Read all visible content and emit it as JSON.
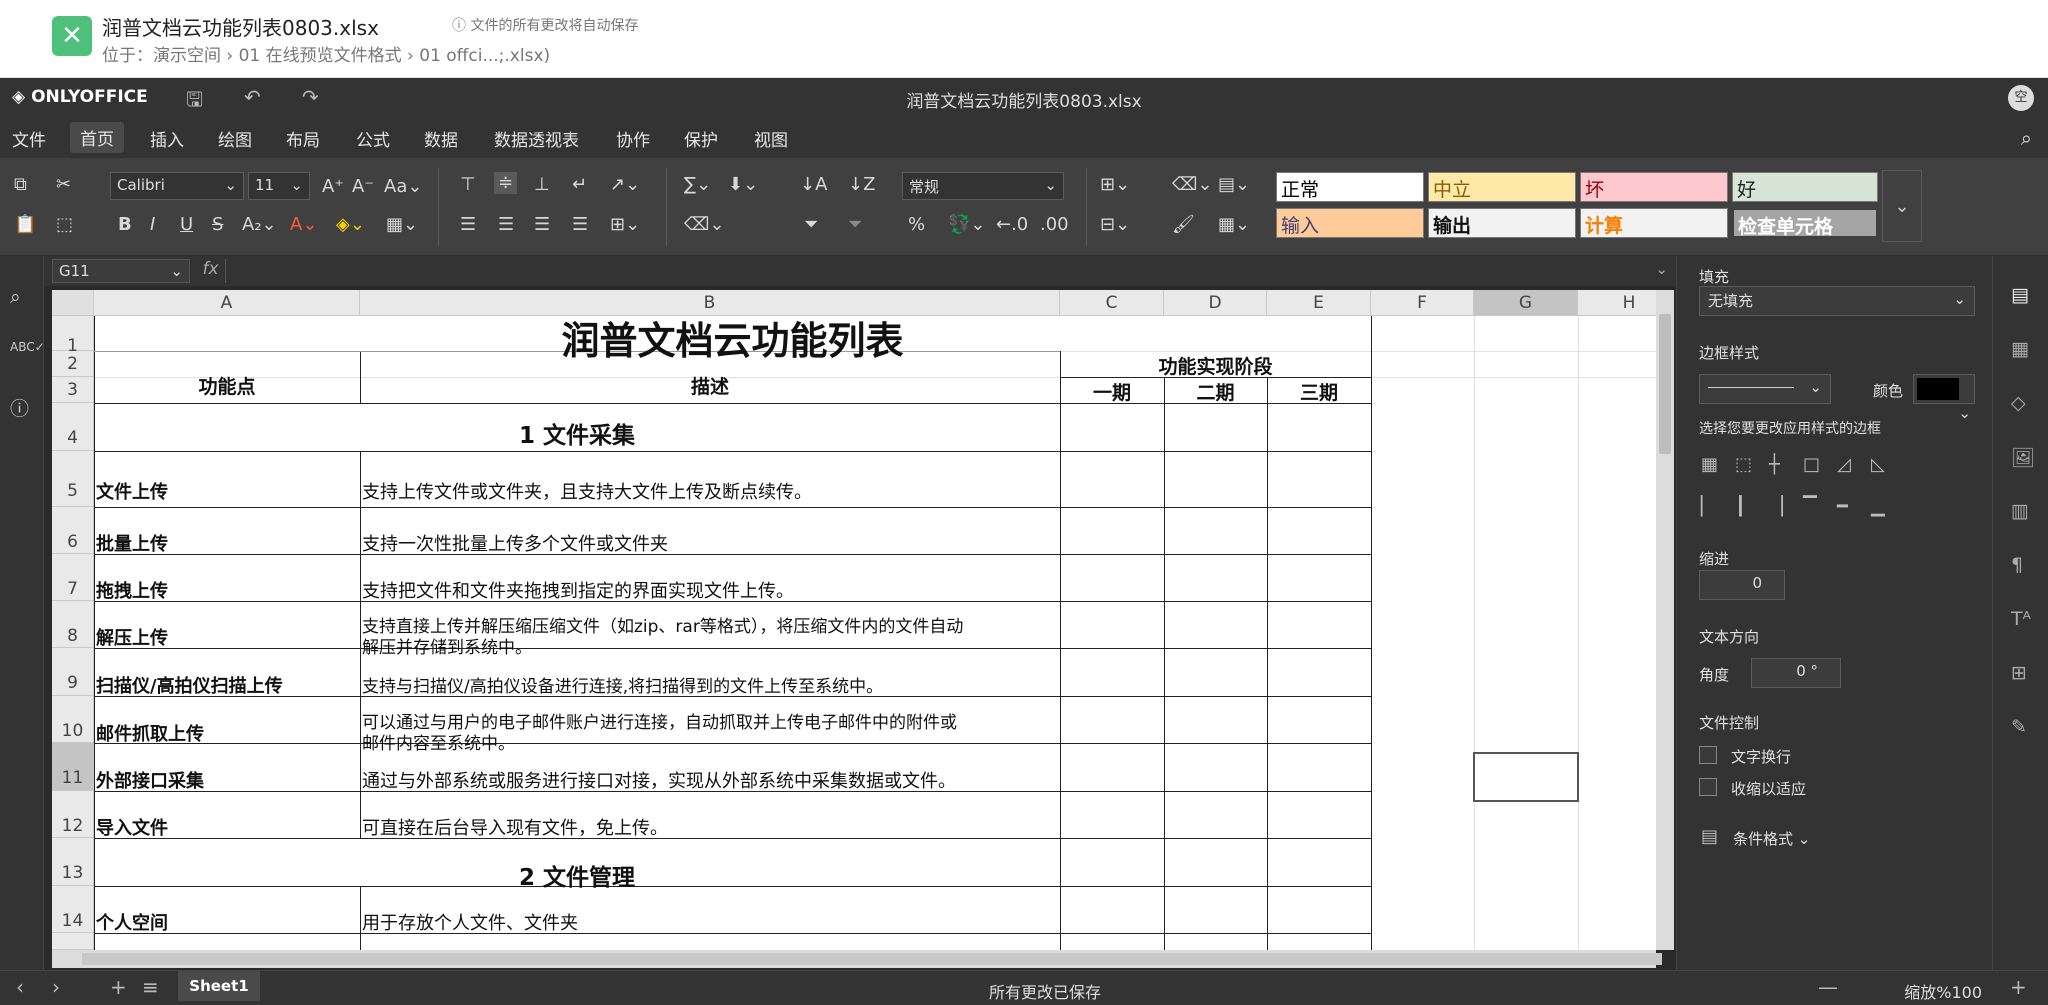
{
  "header": {
    "file_title": "润普文档云功能列表0803.xlsx",
    "autosave_note": "文件的所有更改将自动保存",
    "location": "位于：演示空间 › 01 在线预览文件格式 › 01 offci...;.xlsx)"
  },
  "appbar": {
    "brand": "ONLYOFFICE",
    "doc_title": "润普文档云功能列表0803.xlsx",
    "user_initial": "空"
  },
  "menu": [
    "文件",
    "首页",
    "插入",
    "绘图",
    "布局",
    "公式",
    "数据",
    "数据透视表",
    "协作",
    "保护",
    "视图"
  ],
  "toolbar": {
    "font_name": "Calibri",
    "font_size": "11",
    "number_format": "常规",
    "styles_row1": [
      "正常",
      "中立",
      "坏",
      "好"
    ],
    "styles_row2": [
      "输入",
      "输出",
      "计算",
      "检查单元格"
    ]
  },
  "formula_bar": {
    "cell_ref": "G11",
    "fx": "fx"
  },
  "columns": [
    "A",
    "B",
    "C",
    "D",
    "E",
    "F",
    "G",
    "H"
  ],
  "rows": [
    "1",
    "2",
    "3",
    "4",
    "5",
    "6",
    "7",
    "8",
    "9",
    "10",
    "11",
    "12",
    "13",
    "14"
  ],
  "sheet": {
    "title": "润普文档云功能列表",
    "hdr_feature": "功能点",
    "hdr_desc": "描述",
    "hdr_phase": "功能实现阶段",
    "phase1": "一期",
    "phase2": "二期",
    "phase3": "三期",
    "section1": "1 文件采集",
    "section2": "2 文件管理",
    "items": [
      {
        "name": "文件上传",
        "desc": "支持上传文件或文件夹，且支持大文件上传及断点续传。"
      },
      {
        "name": "批量上传",
        "desc": "支持一次性批量上传多个文件或文件夹"
      },
      {
        "name": "拖拽上传",
        "desc": "支持把文件和文件夹拖拽到指定的界面实现文件上传。"
      },
      {
        "name": "解压上传",
        "desc1": "支持直接上传并解压缩压缩文件（如zip、rar等格式），将压缩文件内的文件自动",
        "desc2": "解压并存储到系统中。"
      },
      {
        "name": "扫描仪/高拍仪扫描上传",
        "desc": "支持与扫描仪/高拍仪设备进行连接,将扫描得到的文件上传至系统中。"
      },
      {
        "name": "邮件抓取上传",
        "desc1": "可以通过与用户的电子邮件账户进行连接，自动抓取并上传电子邮件中的附件或",
        "desc2": "邮件内容至系统中。"
      },
      {
        "name": "外部接口采集",
        "desc": "通过与外部系统或服务进行接口对接，实现从外部系统中采集数据或文件。"
      },
      {
        "name": "导入文件",
        "desc": "可直接在后台导入现有文件，免上传。"
      }
    ],
    "item14": {
      "name": "个人空间",
      "desc": "用于存放个人文件、文件夹"
    }
  },
  "right_panel": {
    "fill_label": "填充",
    "fill_value": "无填充",
    "border_label": "边框样式",
    "color_label": "颜色",
    "border_hint": "选择您要更改应用样式的边框",
    "indent_label": "缩进",
    "indent_value": "0",
    "text_dir_label": "文本方向",
    "angle_label": "角度",
    "angle_value": "0 °",
    "text_control_label": "文件控制",
    "wrap_label": "文字换行",
    "shrink_label": "收缩以适应",
    "cond_format_label": "条件格式"
  },
  "statusbar": {
    "sheet_tab": "Sheet1",
    "status": "所有更改已保存",
    "zoom": "缩放%100"
  }
}
